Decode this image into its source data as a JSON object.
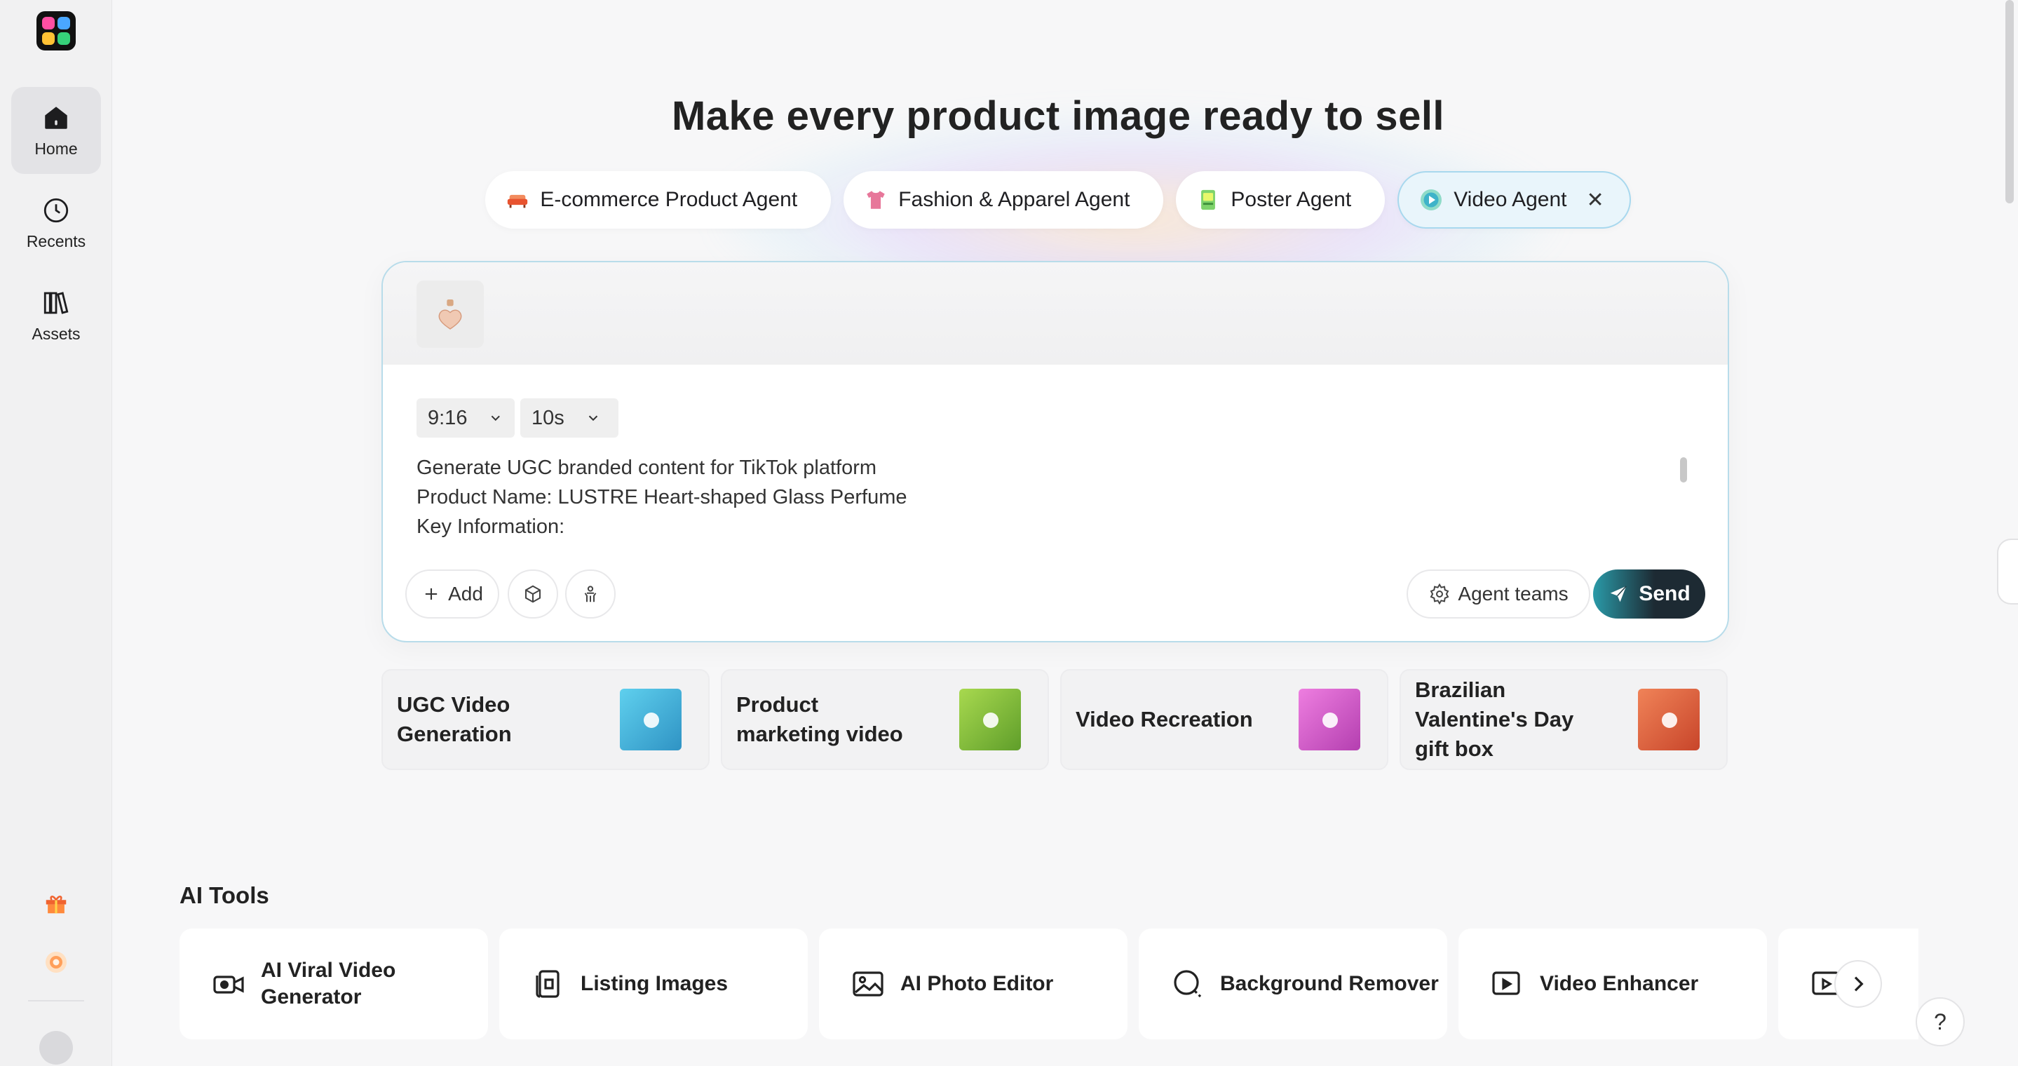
{
  "sidebar": {
    "items": [
      {
        "label": "Home",
        "icon": "home-icon",
        "active": true
      },
      {
        "label": "Recents",
        "icon": "clock-icon"
      },
      {
        "label": "Assets",
        "icon": "library-icon"
      }
    ]
  },
  "headline": "Make every product image ready to sell",
  "agents": [
    {
      "label": "E-commerce Product Agent",
      "icon": "sofa-icon",
      "color": "#e8532f"
    },
    {
      "label": "Fashion & Apparel Agent",
      "icon": "tshirt-icon",
      "color": "#e7779a"
    },
    {
      "label": "Poster Agent",
      "icon": "poster-icon",
      "color": "#7ed36b"
    },
    {
      "label": "Video Agent",
      "icon": "video-play-icon",
      "color": "#3fb3c9",
      "active": true
    }
  ],
  "prompt": {
    "aspect_ratio": "9:16",
    "duration": "10s",
    "lines": [
      "Generate UGC branded content for TikTok platform",
      "Product Name: LUSTRE Heart-shaped Glass Perfume",
      "Key Information:"
    ],
    "add_label": "Add",
    "agent_teams_label": "Agent teams",
    "send_label": "Send"
  },
  "templates": [
    {
      "label": "UGC Video Generation",
      "color": "#4bb8d8"
    },
    {
      "label": "Product marketing video",
      "color": "#8fc23e"
    },
    {
      "label": "Video Recreation",
      "color": "#d85fc8"
    },
    {
      "label": "Brazilian Valentine's Day gift box",
      "color": "#e2623e"
    }
  ],
  "tools": {
    "title": "AI Tools",
    "items": [
      {
        "label": "AI Viral Video Generator",
        "icon": "video-camera-icon"
      },
      {
        "label": "Listing Images",
        "icon": "listing-icon"
      },
      {
        "label": "AI Photo Editor",
        "icon": "photo-edit-icon"
      },
      {
        "label": "Background Remover",
        "icon": "background-remove-icon"
      },
      {
        "label": "Video Enhancer",
        "icon": "video-hd-icon"
      }
    ]
  },
  "help_label": "?"
}
